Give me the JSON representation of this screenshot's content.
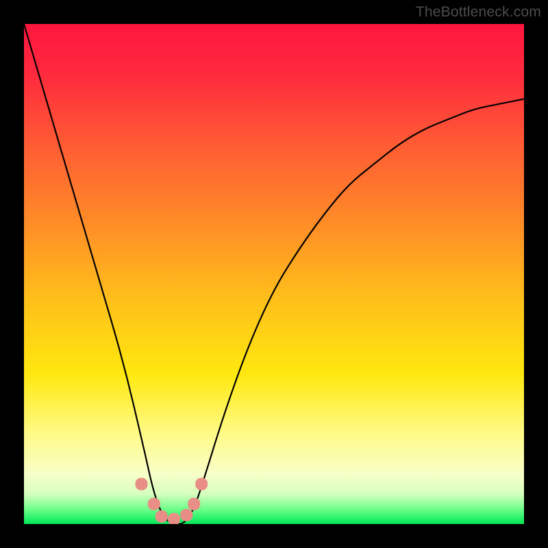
{
  "watermark": "TheBottleneck.com",
  "chart_data": {
    "type": "line",
    "title": "",
    "xlabel": "",
    "ylabel": "",
    "xlim": [
      0,
      100
    ],
    "ylim": [
      0,
      100
    ],
    "grid": false,
    "legend": false,
    "series": [
      {
        "name": "bottleneck-curve",
        "x": [
          0,
          5,
          10,
          15,
          20,
          24,
          26,
          28,
          30,
          32,
          34,
          36,
          40,
          45,
          50,
          55,
          60,
          65,
          70,
          75,
          80,
          85,
          90,
          95,
          100
        ],
        "y": [
          100,
          83,
          66,
          49,
          32,
          15,
          6,
          1,
          0,
          0,
          3,
          9,
          22,
          36,
          47,
          55,
          62,
          68,
          72,
          76,
          79,
          81,
          83,
          84,
          85
        ]
      }
    ],
    "markers": {
      "name": "bottom-cluster",
      "color": "#e98e86",
      "points": [
        {
          "x": 23.5,
          "y": 8
        },
        {
          "x": 26.0,
          "y": 4
        },
        {
          "x": 27.5,
          "y": 1.5
        },
        {
          "x": 30.0,
          "y": 1.0
        },
        {
          "x": 32.5,
          "y": 1.8
        },
        {
          "x": 34.0,
          "y": 4
        },
        {
          "x": 35.5,
          "y": 8
        }
      ]
    },
    "background_gradient": {
      "stops": [
        {
          "offset": 0.0,
          "color": "#ff153e"
        },
        {
          "offset": 0.1,
          "color": "#ff2a3e"
        },
        {
          "offset": 0.25,
          "color": "#ff5e33"
        },
        {
          "offset": 0.4,
          "color": "#ff8d27"
        },
        {
          "offset": 0.55,
          "color": "#ffbf1a"
        },
        {
          "offset": 0.7,
          "color": "#ffe80f"
        },
        {
          "offset": 0.82,
          "color": "#fffb88"
        },
        {
          "offset": 0.9,
          "color": "#f8ffc8"
        },
        {
          "offset": 0.94,
          "color": "#d6ffbe"
        },
        {
          "offset": 0.97,
          "color": "#6fff8a"
        },
        {
          "offset": 1.0,
          "color": "#00e756"
        }
      ]
    }
  }
}
